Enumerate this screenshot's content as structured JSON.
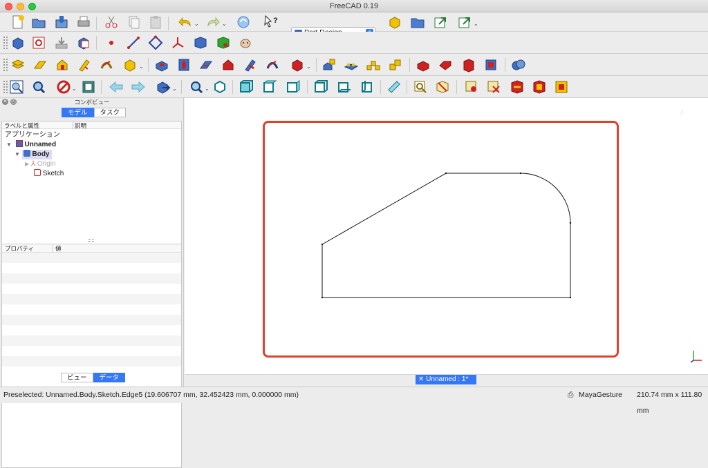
{
  "app": {
    "title": "FreeCAD 0.19"
  },
  "workbench": {
    "selected": "Part Design"
  },
  "combo": {
    "title": "コンボビュー",
    "tabs": [
      "モデル",
      "タスク"
    ],
    "tree_headers": {
      "label": "ラベルと属性",
      "desc": "説明"
    },
    "tree": {
      "root": "アプリケーション",
      "document": "Unnamed",
      "body": "Body",
      "origin": "Origin",
      "sketch": "Sketch"
    },
    "prop_headers": {
      "property": "プロパティ",
      "value": "値"
    },
    "bottom_tabs": [
      "ビュー",
      "データ"
    ]
  },
  "view": {
    "tab_label": "Unnamed : 1*"
  },
  "status": {
    "message": "Preselected: Unnamed.Body.Sketch.Edge5 (19.606707 mm, 32.452423 mm, 0.000000 mm)",
    "navigation": "MayaGesture",
    "dimensions": "210.74 mm x 111.80 mm"
  },
  "colors": {
    "accent": "#3478f6",
    "highlight": "#e0402e"
  }
}
